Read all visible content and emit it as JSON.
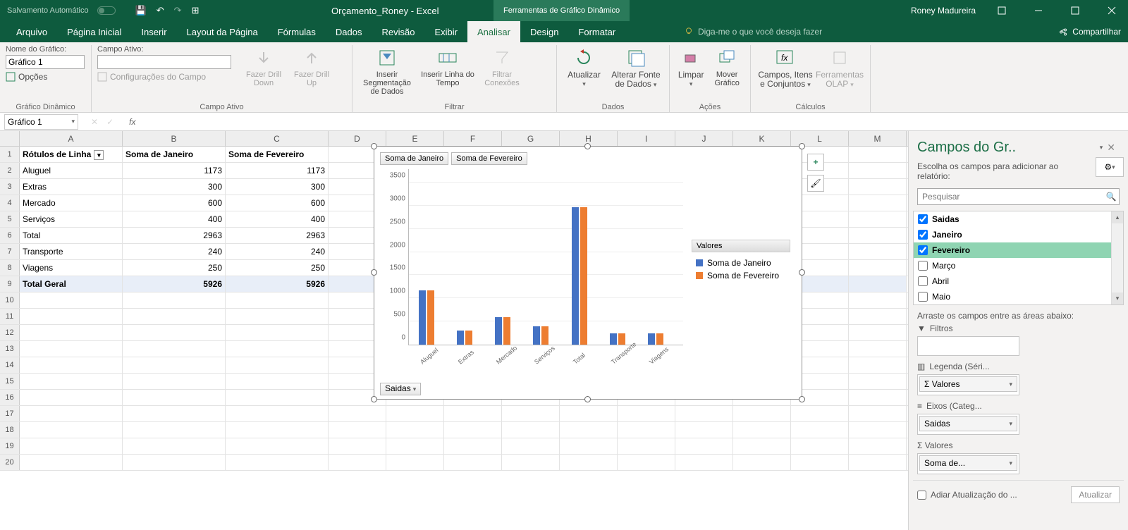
{
  "titlebar": {
    "autosave": "Salvamento Automático",
    "doc_title": "Orçamento_Roney - Excel",
    "context_tab": "Ferramentas de Gráfico Dinâmico",
    "user": "Roney Madureira"
  },
  "ribbon_tabs": [
    "Arquivo",
    "Página Inicial",
    "Inserir",
    "Layout da Página",
    "Fórmulas",
    "Dados",
    "Revisão",
    "Exibir",
    "Analisar",
    "Design",
    "Formatar"
  ],
  "active_tab": "Analisar",
  "tell_me": "Diga-me o que você deseja fazer",
  "share": "Compartilhar",
  "ribbon": {
    "chart_name_label": "Nome do Gráfico:",
    "chart_name": "Gráfico 1",
    "options": "Opções",
    "group1": "Gráfico Dinâmico",
    "active_field_label": "Campo Ativo:",
    "field_settings": "Configurações do Campo",
    "drill_down": "Fazer Drill Down",
    "drill_up": "Fazer Drill Up",
    "group2": "Campo Ativo",
    "slicer": "Inserir Segmentação de Dados",
    "timeline": "Inserir Linha do Tempo",
    "filter_conn": "Filtrar Conexões",
    "group3": "Filtrar",
    "refresh": "Atualizar",
    "change_source": "Alterar Fonte de Dados",
    "group4": "Dados",
    "clear": "Limpar",
    "move_chart": "Mover Gráfico",
    "group5": "Ações",
    "fields_items": "Campos, Itens e Conjuntos",
    "olap": "Ferramentas OLAP",
    "group6": "Cálculos"
  },
  "namebox": "Gráfico 1",
  "columns": [
    "A",
    "B",
    "C",
    "D",
    "E",
    "F",
    "G",
    "H",
    "I",
    "J",
    "K",
    "L",
    "M"
  ],
  "col_widths": {
    "A": 146,
    "B": 146,
    "C": 146,
    "other": 82
  },
  "table": {
    "headers": [
      "Rótulos de Linha",
      "Soma de Janeiro",
      "Soma de Fevereiro"
    ],
    "rows": [
      {
        "r": 2,
        "a": "Aluguel",
        "b": "1173",
        "c": "1173"
      },
      {
        "r": 3,
        "a": "Extras",
        "b": "300",
        "c": "300"
      },
      {
        "r": 4,
        "a": "Mercado",
        "b": "600",
        "c": "600"
      },
      {
        "r": 5,
        "a": "Serviços",
        "b": "400",
        "c": "400"
      },
      {
        "r": 6,
        "a": "Total",
        "b": "2963",
        "c": "2963"
      },
      {
        "r": 7,
        "a": "Transporte",
        "b": "240",
        "c": "240"
      },
      {
        "r": 8,
        "a": "Viagens",
        "b": "250",
        "c": "250"
      }
    ],
    "grand_total": {
      "label": "Total Geral",
      "b": "5926",
      "c": "5926"
    }
  },
  "chart_data": {
    "type": "bar",
    "categories": [
      "Aluguel",
      "Extras",
      "Mercado",
      "Serviços",
      "Total",
      "Transporte",
      "Viagens"
    ],
    "series": [
      {
        "name": "Soma de Janeiro",
        "values": [
          1173,
          300,
          600,
          400,
          2963,
          240,
          250
        ],
        "color": "#4472c4"
      },
      {
        "name": "Soma de Fevereiro",
        "values": [
          1173,
          300,
          600,
          400,
          2963,
          240,
          250
        ],
        "color": "#ed7d31"
      }
    ],
    "legend_title": "Valores",
    "ylim": [
      0,
      3500
    ],
    "yticks": [
      0,
      500,
      1000,
      1500,
      2000,
      2500,
      3000,
      3500
    ],
    "filter_buttons": [
      "Soma de Janeiro",
      "Soma de Fevereiro"
    ],
    "page_filter": "Saidas"
  },
  "field_pane": {
    "title": "Campos do Gr..",
    "subtitle": "Escolha os campos para adicionar ao relatório:",
    "search_placeholder": "Pesquisar",
    "fields": [
      {
        "name": "Saidas",
        "checked": true,
        "bold": true
      },
      {
        "name": "Janeiro",
        "checked": true,
        "bold": true
      },
      {
        "name": "Fevereiro",
        "checked": true,
        "bold": true,
        "highlight": true
      },
      {
        "name": "Março",
        "checked": false
      },
      {
        "name": "Abril",
        "checked": false
      },
      {
        "name": "Maio",
        "checked": false
      }
    ],
    "drag_hint": "Arraste os campos entre as áreas abaixo:",
    "zones": {
      "filters": {
        "label": "Filtros",
        "items": []
      },
      "legend": {
        "label": "Legenda (Séri...",
        "items": [
          "Σ Valores"
        ]
      },
      "axis": {
        "label": "Eixos (Categ...",
        "items": [
          "Saidas"
        ]
      },
      "values": {
        "label": "Σ  Valores",
        "items": [
          "Soma de..."
        ]
      }
    },
    "defer": "Adiar Atualização do ...",
    "update": "Atualizar"
  }
}
